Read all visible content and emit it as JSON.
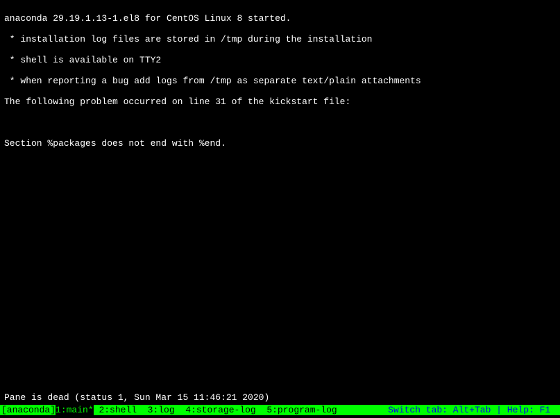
{
  "terminal": {
    "lines": [
      "anaconda 29.19.1.13-1.el8 for CentOS Linux 8 started.",
      " * installation log files are stored in /tmp during the installation",
      " * shell is available on TTY2",
      " * when reporting a bug add logs from /tmp as separate text/plain attachments",
      "The following problem occurred on line 31 of the kickstart file:",
      "",
      "Section %packages does not end with %end."
    ],
    "pane_dead": "Pane is dead (status 1, Sun Mar 15 11:46:21 2020)"
  },
  "status_bar": {
    "session": "[anaconda]",
    "tabs": {
      "t1": "1:main*",
      "t2": "2:shell",
      "t3": "3:log",
      "t4": "4:storage-log",
      "t5": "5:program-log"
    },
    "help": "Switch tab: Alt+Tab | Help: F1 "
  }
}
